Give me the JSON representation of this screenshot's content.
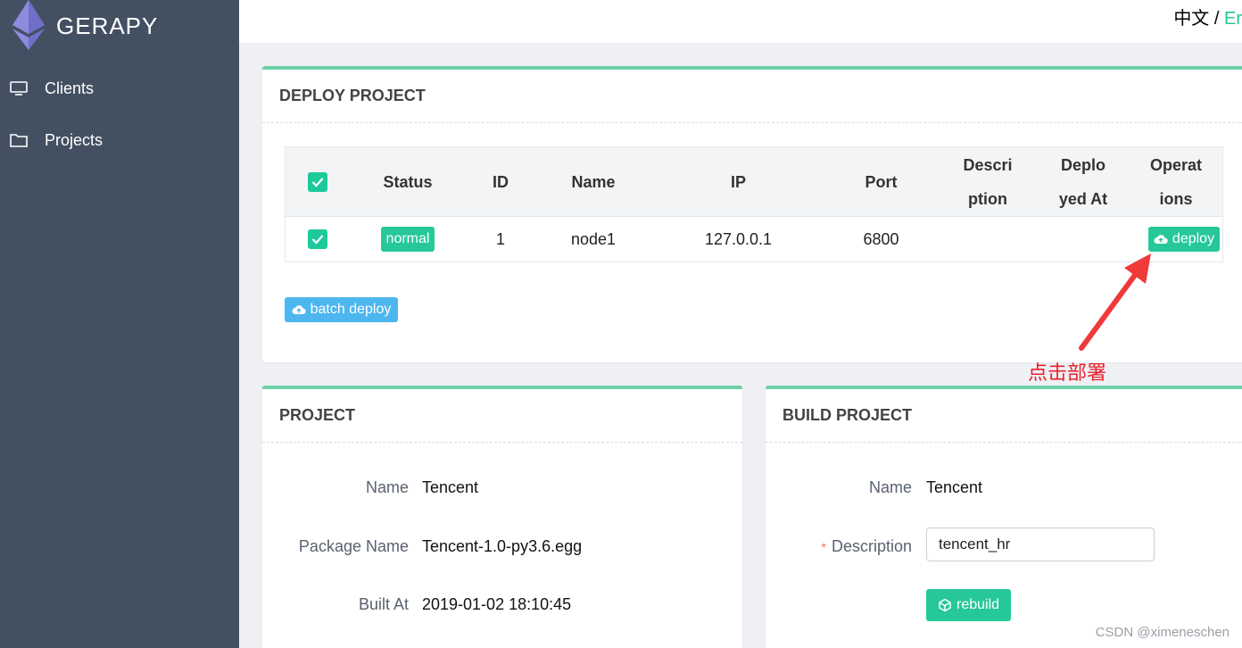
{
  "app": {
    "brand": "GERAPY"
  },
  "sidebar": {
    "items": [
      {
        "label": "Clients",
        "icon": "monitor-icon"
      },
      {
        "label": "Projects",
        "icon": "folder-icon"
      }
    ]
  },
  "topbar": {
    "lang_zh": "中文",
    "lang_sep": "/",
    "lang_en": "Er"
  },
  "deploy": {
    "title": "DEPLOY PROJECT",
    "columns": [
      "Status",
      "ID",
      "Name",
      "IP",
      "Port",
      "Descri ption",
      "Deplo yed At",
      "Operat ions"
    ],
    "row": {
      "status": "normal",
      "id": "1",
      "name": "node1",
      "ip": "127.0.0.1",
      "port": "6800",
      "description": "",
      "deployed_at": "",
      "operation": "deploy"
    },
    "batch_label": "batch deploy"
  },
  "project": {
    "title": "PROJECT",
    "fields": [
      {
        "label": "Name",
        "value": "Tencent"
      },
      {
        "label": "Package Name",
        "value": "Tencent-1.0-py3.6.egg"
      },
      {
        "label": "Built At",
        "value": "2019-01-02 18:10:45"
      }
    ]
  },
  "build": {
    "title": "BUILD PROJECT",
    "name_label": "Name",
    "name_value": "Tencent",
    "required_mark": "*",
    "description_label": "Description",
    "description_value": "tencent_hr",
    "rebuild_label": "rebuild"
  },
  "annotation": "点击部署",
  "watermark": "CSDN @ximeneschen",
  "colors": {
    "sidebar": "#435062",
    "accent": "#26c89a",
    "batch": "#4db6ee",
    "annotation": "#e8222b"
  }
}
